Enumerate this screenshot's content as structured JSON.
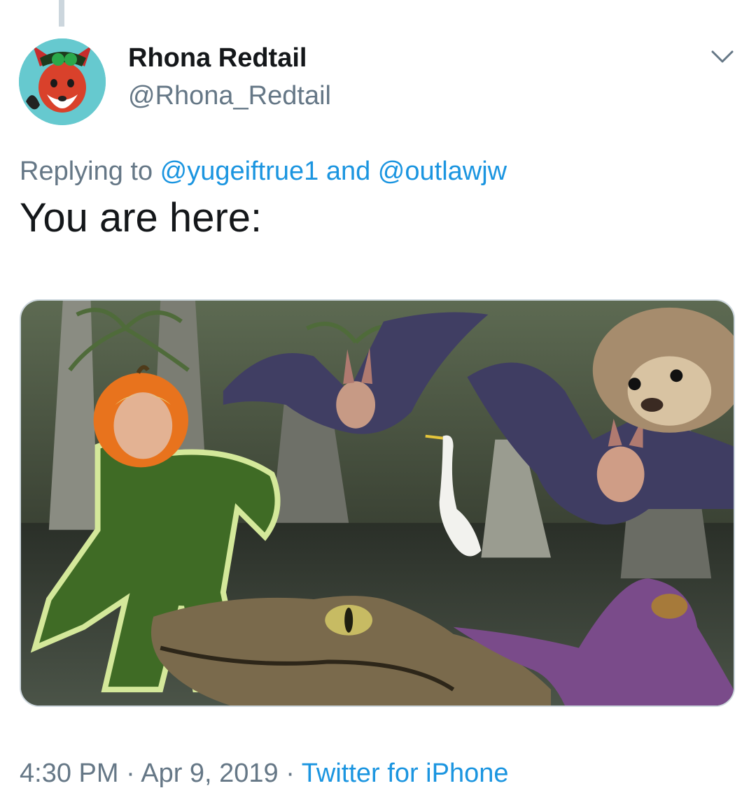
{
  "author": {
    "display_name": "Rhona Redtail",
    "handle": "@Rhona_Redtail",
    "avatar_icon": "fox-avatar-icon"
  },
  "reply": {
    "prefix": "Replying to ",
    "user1": "@yugeiftrue1",
    "conjunction": " and ",
    "user2": "@outlawjw"
  },
  "tweet": {
    "text": "You are here:"
  },
  "media": {
    "description_icon": "swamp-collage-image"
  },
  "meta": {
    "time": "4:30 PM",
    "separator1": " · ",
    "date": "Apr 9, 2019",
    "separator2": " · ",
    "source": "Twitter for iPhone"
  },
  "colors": {
    "link": "#1b95e0",
    "secondary_text": "#657786",
    "primary_text": "#14171a",
    "border": "#ccd6dd"
  },
  "icons": {
    "more_menu": "chevron-down-icon"
  }
}
